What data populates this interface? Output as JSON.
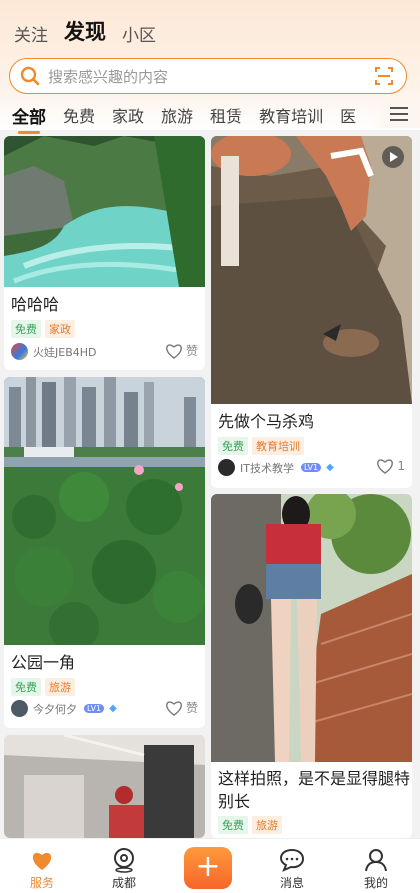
{
  "top_tabs": [
    "关注",
    "发现",
    "小区"
  ],
  "search": {
    "placeholder": "搜索感兴趣的内容"
  },
  "categories": [
    "全部",
    "免费",
    "家政",
    "旅游",
    "租赁",
    "教育培训",
    "医"
  ],
  "posts": [
    {
      "title": "哈哈哈",
      "tags": [
        "免费",
        "家政"
      ],
      "author": "火娃JEB4HD",
      "likes": "赞"
    },
    {
      "title": "先做个马杀鸡",
      "tags": [
        "免费",
        "教育培训"
      ],
      "author": "IT技术教学",
      "level": "LV1",
      "likes": "1"
    },
    {
      "title": "公园一角",
      "tags": [
        "免费",
        "旅游"
      ],
      "author": "今夕何夕",
      "level": "LV1",
      "likes": "赞"
    },
    {
      "title_line1": "这样拍照，是不是显得腿特",
      "title_line2": "别长",
      "tags": [
        "免费",
        "旅游"
      ]
    }
  ],
  "bottom_nav": [
    {
      "label": "服务",
      "icon": "heart-icon"
    },
    {
      "label": "成都",
      "icon": "location-pin-icon"
    },
    {
      "label": "+",
      "icon": "plus-icon"
    },
    {
      "label": "消息",
      "icon": "chat-bubble-icon"
    },
    {
      "label": "我的",
      "icon": "person-icon"
    }
  ],
  "colors": {
    "accent": "#f08a2e",
    "free_tag": "#3aa45a",
    "category_tag": "#e67b2c"
  }
}
